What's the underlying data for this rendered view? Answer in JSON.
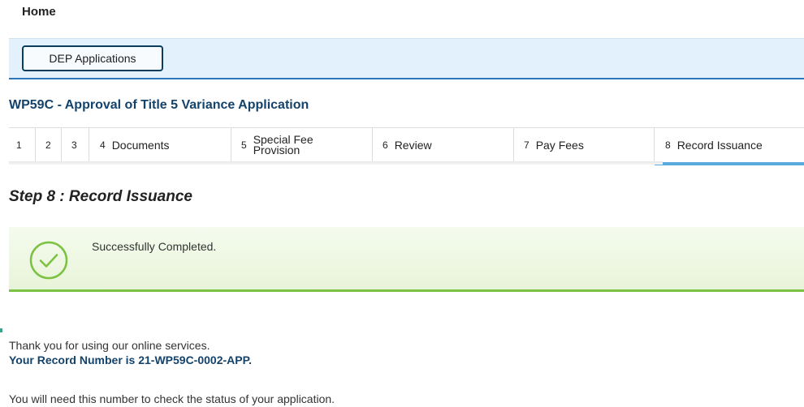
{
  "nav": {
    "home_label": "Home"
  },
  "module": {
    "button_label": "DEP Applications"
  },
  "application": {
    "title": "WP59C - Approval of Title 5 Variance Application"
  },
  "steps": [
    {
      "num": "1",
      "label": ""
    },
    {
      "num": "2",
      "label": ""
    },
    {
      "num": "3",
      "label": ""
    },
    {
      "num": "4",
      "label": "Documents"
    },
    {
      "num": "5",
      "label": "Special Fee Provision"
    },
    {
      "num": "6",
      "label": "Review"
    },
    {
      "num": "7",
      "label": "Pay Fees"
    },
    {
      "num": "8",
      "label": "Record Issuance",
      "active": true
    }
  ],
  "step_heading": "Step 8 : Record Issuance",
  "success": {
    "message": "Successfully Completed.",
    "icon": "check-circle-icon",
    "color": "#7cc242"
  },
  "confirmation": {
    "thanks": "Thank you for using our online services.",
    "record_number_text": "Your Record Number is 21-WP59C-0002-APP.",
    "status_note": "You will need this number to check the status of your application."
  },
  "colors": {
    "accent": "#2a76b8",
    "title": "#13426b",
    "active_step": "#5aa9dc",
    "success_border": "#7cc242"
  }
}
